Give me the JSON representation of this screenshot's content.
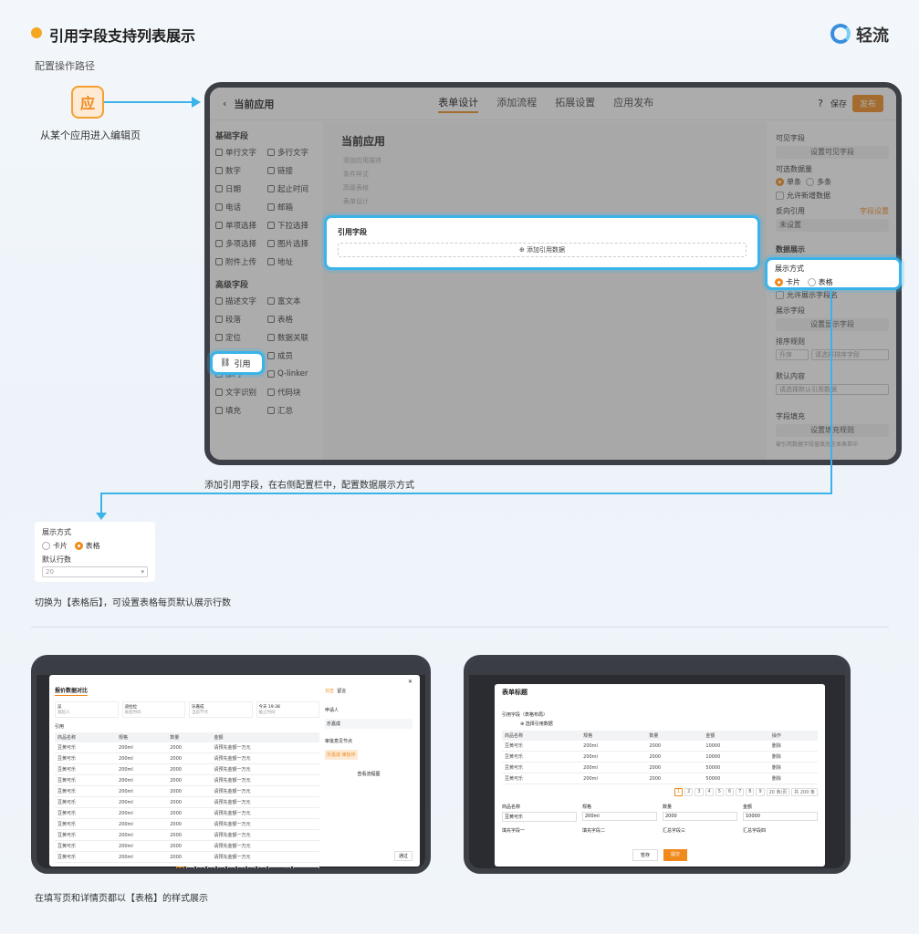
{
  "header": {
    "title": "引用字段支持列表展示",
    "brand": "轻流"
  },
  "config_path": {
    "label": "配置操作路径",
    "app_icon_char": "应",
    "enter_edit_caption": "从某个应用进入编辑页"
  },
  "editor": {
    "app_name": "当前应用",
    "tabs": [
      "表单设计",
      "添加流程",
      "拓展设置",
      "应用发布"
    ],
    "save_label": "保存",
    "publish_label": "发布",
    "basic_group": "基础字段",
    "basic_fields": [
      "单行文字",
      "多行文字",
      "数字",
      "链接",
      "日期",
      "起止时间",
      "电话",
      "邮箱",
      "单项选择",
      "下拉选择",
      "多项选择",
      "图片选择",
      "附件上传",
      "地址"
    ],
    "advanced_group": "高级字段",
    "advanced_fields": [
      "描述文字",
      "富文本",
      "段落",
      "表格",
      "定位",
      "数据关联",
      "引用",
      "成员",
      "部门",
      "Q-linker",
      "文字识别",
      "代码块",
      "填充",
      "汇总"
    ],
    "canvas_title": "当前应用",
    "canvas_hints": [
      "添加应用描述",
      "条件样式",
      "高级表格",
      "表单设计"
    ],
    "ref_field_label": "引用字段",
    "add_ref_data": "添加引用数据",
    "right_panel": {
      "visible_fields": "可见字段",
      "set_visible_btn": "设置可见字段",
      "selectable_count": "可选数据量",
      "single": "单条",
      "multiple": "多条",
      "allow_new": "允许新增数据",
      "reverse_ref": "反向引用",
      "reverse_link": "字段设置",
      "not_set": "未设置",
      "data_display": "数据展示",
      "display_mode": "展示方式",
      "card": "卡片",
      "table": "表格",
      "allow_display_header": "允许展示字段名",
      "display_fields": "展示字段",
      "set_display_btn": "设置显示字段",
      "sort_rule": "排序规则",
      "asc": "升序",
      "sort_placeholder": "请选择排序字段",
      "default_content": "默认内容",
      "default_placeholder": "请选择默认引用数据",
      "field_fill": "字段填充",
      "set_fill_btn": "设置填充规则",
      "fill_hint": "被引用数据字段值填充至本表单中"
    }
  },
  "step_caption": "添加引用字段，在右侧配置栏中，配置数据展示方式",
  "table_callout": {
    "display_mode": "展示方式",
    "card": "卡片",
    "table": "表格",
    "default_rows": "默认行数",
    "rows_value": "20",
    "caption": "切换为【表格后】，可设置表格每页默认展示行数"
  },
  "detail_page": {
    "top_tabs": [
      "通过",
      "驳回"
    ],
    "title": "报价数据对比",
    "info": [
      {
        "label": "发起人",
        "value": "吴"
      },
      {
        "label": "发起时间",
        "value": "迪拉拉"
      },
      {
        "label": "当前节点",
        "value": "乐嘉成"
      },
      {
        "label": "截止时间",
        "value": "今天 19:38"
      }
    ],
    "section": "引用",
    "columns": [
      "商品名称",
      "规格",
      "数量",
      "金额"
    ],
    "rows": [
      [
        "豆黄可乐",
        "200ml",
        "2000",
        "请预先金额一万元"
      ],
      [
        "豆黄可乐",
        "200ml",
        "2000",
        "请预先金额一万元"
      ],
      [
        "豆黄可乐",
        "200ml",
        "2000",
        "请预先金额一万元"
      ],
      [
        "豆黄可乐",
        "200ml",
        "2000",
        "请预先金额一万元"
      ],
      [
        "豆黄可乐",
        "200ml",
        "2000",
        "请预先金额一万元"
      ],
      [
        "豆黄可乐",
        "200ml",
        "2000",
        "请预先金额一万元"
      ],
      [
        "豆黄可乐",
        "200ml",
        "2000",
        "请预先金额一万元"
      ],
      [
        "豆黄可乐",
        "200ml",
        "2000",
        "请预先金额一万元"
      ],
      [
        "豆黄可乐",
        "200ml",
        "2000",
        "请预先金额一万元"
      ],
      [
        "豆黄可乐",
        "200ml",
        "2000",
        "请预先金额一万元"
      ],
      [
        "豆黄可乐",
        "200ml",
        "2000",
        "请预先金额一万元"
      ]
    ],
    "pages": [
      "1",
      "2",
      "3",
      "4",
      "5",
      "6",
      "7",
      "8",
      "9"
    ],
    "page_size": "20 条/页",
    "total": "共 200 条",
    "log_tabs": [
      "日志",
      "留言"
    ],
    "log_items": [
      "申请人",
      "乐嘉成",
      "审批意见节点",
      "乐嘉成 审批中"
    ],
    "view_flow": "查看流程图",
    "btn_pass": "通过"
  },
  "fill_page": {
    "form_title": "表单标题",
    "ref_label": "引用字段（表格布局）",
    "add_ref": "选择引用数据",
    "columns": [
      "商品名称",
      "规格",
      "数量",
      "金额",
      "操作"
    ],
    "rows": [
      [
        "豆黄可乐",
        "200ml",
        "2000",
        "10000",
        "删除"
      ],
      [
        "豆黄可乐",
        "200ml",
        "2000",
        "10000",
        "删除"
      ],
      [
        "豆黄可乐",
        "200ml",
        "2000",
        "50000",
        "删除"
      ],
      [
        "豆黄可乐",
        "200ml",
        "2000",
        "50000",
        "删除"
      ]
    ],
    "pages": [
      "1",
      "2",
      "3",
      "4",
      "5",
      "6",
      "7",
      "8",
      "9"
    ],
    "page_size": "20 条/页",
    "total": "共 200 条",
    "fields": [
      {
        "label": "商品名称",
        "value": "豆黄可乐"
      },
      {
        "label": "规格",
        "value": "200ml"
      },
      {
        "label": "数量",
        "value": "2000"
      },
      {
        "label": "金额",
        "value": "10000"
      }
    ],
    "fields2": [
      "填充字段一",
      "填充字段二",
      "汇总字段三",
      "汇总字段四"
    ],
    "btn_temp": "暂存",
    "btn_submit": "提交"
  },
  "bottom_caption": "在填写页和详情页都以【表格】的样式展示",
  "colors": {
    "accent": "#f08a1c",
    "highlight": "#3ab3e8"
  }
}
